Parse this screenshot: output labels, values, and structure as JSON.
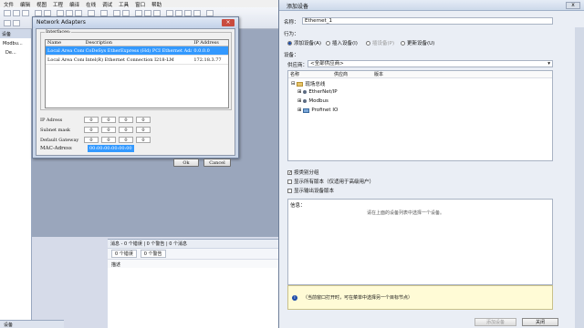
{
  "menubar": [
    "文件",
    "编辑",
    "视图",
    "工程",
    "编译",
    "在线",
    "调试",
    "工具",
    "窗口",
    "帮助"
  ],
  "leftpane": {
    "header": "设备",
    "nodes": [
      "Modbu...",
      "De..."
    ],
    "bottom_tab": "设备"
  },
  "messages": {
    "header": "消息 - 0 个错误 | 0 个警告 | 0 个消息",
    "errors": "0 个错误",
    "warnings": "0 个警告",
    "col": "描述"
  },
  "network_dialog": {
    "title": "Network Adapters",
    "group": "Interfaces:",
    "columns": [
      "Name",
      "Description",
      "IP Address"
    ],
    "rows": [
      [
        "Local Area Connection",
        "CoDeSys EtherExpress (Hd) PCI Ethernet Adapter",
        "0.0.0.0"
      ],
      [
        "Local Area Connection 2",
        "Intel(R) Ethernet Connection I218-LM",
        "172.18.3.77"
      ]
    ],
    "ip_label": "IP Adress",
    "ip": [
      "0",
      "0",
      "0",
      "0"
    ],
    "mask_label": "Subnet mask",
    "mask": [
      "0",
      "0",
      "0",
      "0"
    ],
    "gw_label": "Default Gateway",
    "gw": [
      "0",
      "0",
      "0",
      "0"
    ],
    "mac_label": "MAC-Adress",
    "mac": "00:00:00:00:00:00",
    "ok": "Ok",
    "cancel": "Cancel"
  },
  "add_device": {
    "title": "添加设备",
    "close": "x",
    "name_label": "名称：",
    "name_value": "Ethernet_1",
    "action_label": "行为：",
    "actions": [
      "添加设备(A)",
      "插入设备(I)",
      "插设备(P)",
      "更新设备(U)"
    ],
    "device_label": "设备：",
    "vendor_label": "供应商：",
    "vendor_value": "<全部供应商>",
    "cols": [
      "名称",
      "供应商",
      "版本"
    ],
    "tree_root": "现场总线",
    "tree_items": [
      "EtherNet/IP",
      "Modbus",
      "Profinet IO"
    ],
    "opts": [
      "按类别分组",
      "显示所有版本（仅适用于高级用户）",
      "显示输出设备版本"
    ],
    "info_label": "信息：",
    "info_text": "请在上面的设备列表中选择一个设备。",
    "hint": "（当前窗口打开时，可在菜单中选择另一个目标节点）",
    "add_btn": "添加设备",
    "close_btn": "关闭"
  }
}
